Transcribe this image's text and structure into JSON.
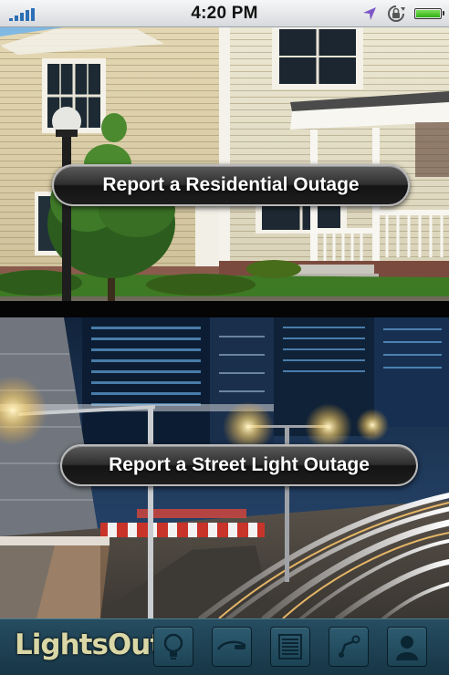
{
  "status_bar": {
    "time": "4:20 PM",
    "icons": [
      "signal-icon",
      "location-arrow-icon",
      "rotation-lock-icon",
      "battery-icon"
    ],
    "battery_color": "#2fae13"
  },
  "residential": {
    "button_label": "Report a Residential Outage"
  },
  "street": {
    "button_label": "Report a Street Light Outage"
  },
  "tab_bar": {
    "logo_text": "LightsOut",
    "tabs": [
      {
        "icon": "lightbulb-icon"
      },
      {
        "icon": "street-lamp-icon"
      },
      {
        "icon": "list-icon"
      },
      {
        "icon": "map-route-icon"
      },
      {
        "icon": "profile-icon"
      }
    ],
    "background_color": "#1f4455",
    "icon_color": "#0b2633"
  }
}
